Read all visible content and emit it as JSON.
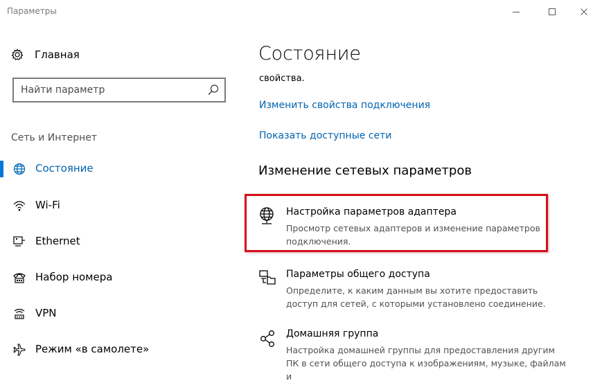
{
  "window": {
    "title": "Параметры"
  },
  "sidebar": {
    "home_label": "Главная",
    "search_placeholder": "Найти параметр",
    "section_title": "Сеть и Интернет",
    "items": [
      {
        "label": "Состояние",
        "icon": "globe-icon"
      },
      {
        "label": "Wi-Fi",
        "icon": "wifi-icon"
      },
      {
        "label": "Ethernet",
        "icon": "ethernet-icon"
      },
      {
        "label": "Набор номера",
        "icon": "dialup-icon"
      },
      {
        "label": "VPN",
        "icon": "vpn-icon"
      },
      {
        "label": "Режим «в самолете»",
        "icon": "airplane-icon"
      }
    ]
  },
  "main": {
    "title": "Состояние",
    "properties_text": "свойства.",
    "links": [
      "Изменить свойства подключения",
      "Показать доступные сети"
    ],
    "section_title": "Изменение сетевых параметров",
    "options": [
      {
        "title": "Настройка параметров адаптера",
        "description": "Просмотр сетевых адаптеров и изменение параметров подключения.",
        "icon": "adapter-globe-icon"
      },
      {
        "title": "Параметры общего доступа",
        "description": "Определите, к каким данным вы хотите предоставить доступ для сетей, с которыми установлено соединение.",
        "icon": "sharing-icon"
      },
      {
        "title": "Домашняя группа",
        "description": "Настройка домашней группы для предоставления другим ПК в сети общего доступа к изображениям, музыке, файлам и",
        "icon": "homegroup-icon"
      }
    ]
  },
  "colors": {
    "accent": "#0078d7",
    "link": "#0063b1",
    "highlight": "#d4101a"
  }
}
